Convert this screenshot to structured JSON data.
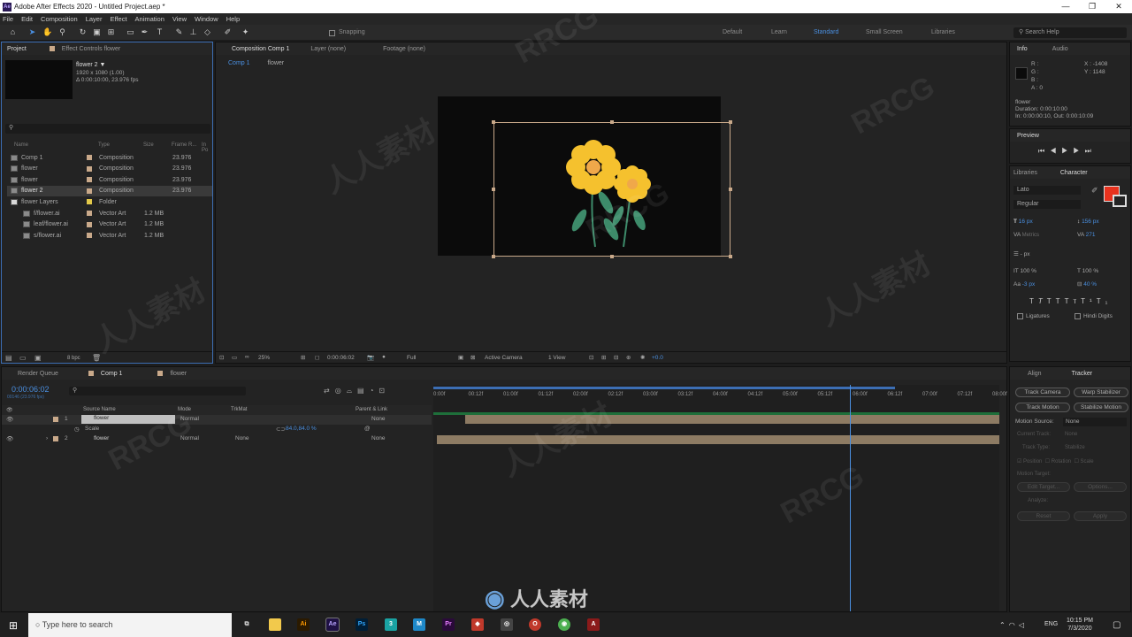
{
  "window": {
    "title": "Adobe After Effects 2020 - Untitled Project.aep *",
    "minimize": "—",
    "maximize": "❐",
    "close": "✕",
    "logo": "Ae"
  },
  "menu": [
    "File",
    "Edit",
    "Composition",
    "Layer",
    "Effect",
    "Animation",
    "View",
    "Window",
    "Help"
  ],
  "toolbar": {
    "snapping": "Snapping",
    "workspaces": [
      "Default",
      "Learn",
      "Standard",
      "Small Screen",
      "Libraries"
    ],
    "search_help": "Search Help"
  },
  "project": {
    "tab": "Project",
    "effect_controls_tab": "Effect Controls flower",
    "selected_name": "flower 2 ▼",
    "selected_dims": "1920 x 1080 (1.00)",
    "selected_duration": "Δ 0:00:10:00, 23.976 fps",
    "columns": [
      "Name",
      "Type",
      "Size",
      "Frame R...",
      "In Po"
    ],
    "items": [
      {
        "name": "Comp 1",
        "type": "Composition",
        "size": "",
        "fps": "23.976",
        "color": "#c9a98a"
      },
      {
        "name": "flower",
        "type": "Composition",
        "size": "",
        "fps": "23.976",
        "color": "#c9a98a"
      },
      {
        "name": "flower",
        "type": "Composition",
        "size": "",
        "fps": "23.976",
        "color": "#c9a98a"
      },
      {
        "name": "flower 2",
        "type": "Composition",
        "size": "",
        "fps": "23.976",
        "color": "#c9a98a"
      },
      {
        "name": "flower Layers",
        "type": "Folder",
        "size": "",
        "fps": "",
        "color": "#e3c94a"
      },
      {
        "name": "f/flower.ai",
        "type": "Vector Art",
        "size": "1.2 MB",
        "fps": "",
        "color": "#c9a98a"
      },
      {
        "name": "leaf/flower.ai",
        "type": "Vector Art",
        "size": "1.2 MB",
        "fps": "",
        "color": "#c9a98a"
      },
      {
        "name": "s/flower.ai",
        "type": "Vector Art",
        "size": "1.2 MB",
        "fps": "",
        "color": "#c9a98a"
      }
    ],
    "bpc": "8 bpc"
  },
  "composition": {
    "tab": "Composition Comp 1",
    "layer_tab": "Layer (none)",
    "footage_tab": "Footage (none)",
    "breadcrumbs": [
      "Comp 1",
      "flower"
    ],
    "zoom": "25%",
    "timecode": "0:00:06:02",
    "resolution": "Full",
    "camera": "Active Camera",
    "views": "1 View",
    "exposure": "+0.0"
  },
  "info": {
    "tab": "Info",
    "audio_tab": "Audio",
    "r": "R :",
    "g": "G :",
    "b": "B :",
    "a": "A : 0",
    "x": "X : -1408",
    "y": "Y : 1148",
    "layer": "flower",
    "duration": "Duration: 0:00:10:00",
    "inout": "In: 0:00:00:10, Out: 0:00:10:09"
  },
  "preview": {
    "tab": "Preview"
  },
  "character": {
    "libraries_tab": "Libraries",
    "tab": "Character",
    "font": "Lato",
    "style": "Regular",
    "size": "16 px",
    "leading": "156 px",
    "kerning": "Metrics",
    "tracking": "271",
    "stroke": "- px",
    "vscale": "100 %",
    "hscale": "100 %",
    "baseline": "-3 px",
    "tsume": "40 %",
    "ligatures": "Ligatures",
    "hindi": "Hindi Digits",
    "fill_color": "#e8321e"
  },
  "tracker": {
    "align_tab": "Align",
    "tab": "Tracker",
    "track_camera": "Track Camera",
    "warp_stabilizer": "Warp Stabilizer",
    "track_motion": "Track Motion",
    "stabilize_motion": "Stabilize Motion",
    "motion_source_label": "Motion Source:",
    "motion_source": "None",
    "current_track": "Current Track:",
    "current_track_val": "None",
    "track_type": "Track Type:",
    "track_type_val": "Stabilize",
    "position": "Position",
    "rotation": "Rotation",
    "scale": "Scale",
    "motion_target": "Motion Target:",
    "edit_target": "Edit Target...",
    "options": "Options...",
    "analyze": "Analyze:",
    "reset": "Reset",
    "apply": "Apply"
  },
  "timeline": {
    "render_queue_tab": "Render Queue",
    "comp_tab": "Comp 1",
    "flower_tab": "flower",
    "timecode": "0:00:06:02",
    "frames": "00146 (23.976 fps)",
    "col_source": "Source Name",
    "col_mode": "Mode",
    "col_trkmat": "TrkMat",
    "col_parent": "Parent & Link",
    "layers": [
      {
        "num": "1",
        "name": "flower",
        "mode": "Normal",
        "trkmat": "",
        "parent": "None"
      },
      {
        "num": "2",
        "name": "flower",
        "mode": "Normal",
        "trkmat": "None",
        "parent": "None"
      }
    ],
    "scale_label": "Scale",
    "scale_value": "84.0,84.0 %",
    "ruler": [
      "0:00f",
      "00:12f",
      "01:00f",
      "01:12f",
      "02:00f",
      "02:12f",
      "03:00f",
      "03:12f",
      "04:00f",
      "04:12f",
      "05:00f",
      "05:12f",
      "06:00f",
      "06:12f",
      "07:00f",
      "07:12f",
      "08:00f"
    ],
    "playhead_fraction": 0.75
  },
  "taskbar": {
    "search": "Type here to search",
    "time": "10:15 PM",
    "date": "7/3/2020",
    "lang": "ENG"
  },
  "watermark": {
    "logo": "RRCG",
    "chinese": "人人素材"
  }
}
